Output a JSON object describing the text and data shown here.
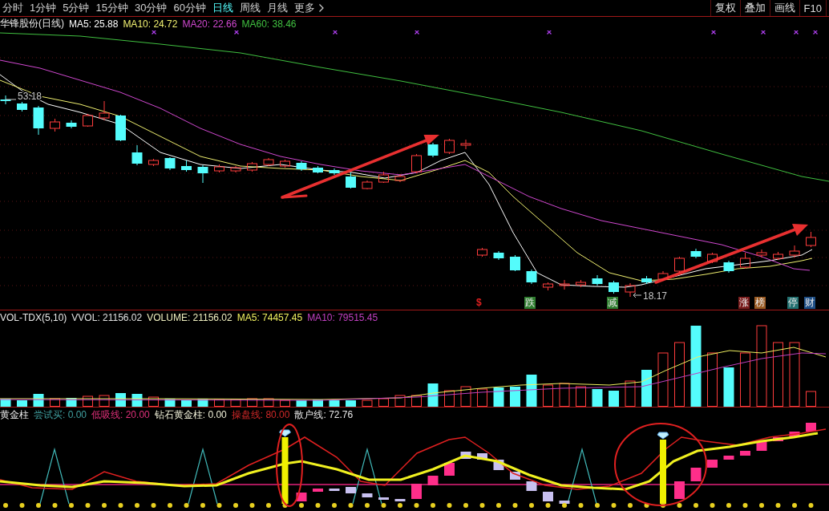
{
  "toolbar": {
    "tabs": [
      {
        "label": "分时",
        "selected": false,
        "kind": "period"
      },
      {
        "label": "1分钟",
        "selected": false,
        "kind": "period"
      },
      {
        "label": "5分钟",
        "selected": false,
        "kind": "period"
      },
      {
        "label": "15分钟",
        "selected": false,
        "kind": "period"
      },
      {
        "label": "30分钟",
        "selected": false,
        "kind": "period"
      },
      {
        "label": "60分钟",
        "selected": false,
        "kind": "period"
      },
      {
        "label": "日线",
        "selected": true,
        "kind": "period"
      },
      {
        "label": "周线",
        "selected": false,
        "kind": "period"
      },
      {
        "label": "月线",
        "selected": false,
        "kind": "period"
      },
      {
        "label": "更多",
        "selected": false,
        "kind": "menu"
      }
    ],
    "buttons": [
      "复权",
      "叠加",
      "画线",
      "F10"
    ]
  },
  "main_chart": {
    "title": "华锋股份(日线)",
    "indicators": [
      {
        "label": "MA5: 25.88",
        "color": "#ffffff"
      },
      {
        "label": "MA10: 24.72",
        "color": "#f0f070"
      },
      {
        "label": "MA20: 22.66",
        "color": "#d048d0"
      },
      {
        "label": "MA60: 38.46",
        "color": "#40c040"
      }
    ],
    "high_label": "53.18",
    "low_label": "18.17",
    "events": [
      {
        "label": "$",
        "kind": "text",
        "color": "#e02020"
      },
      {
        "label": "跌",
        "kind": "badge",
        "color": "#2f7d2f"
      },
      {
        "label": "减",
        "kind": "badge",
        "color": "#2f7d2f"
      },
      {
        "label": "涨",
        "kind": "badge",
        "color": "#7a1c1c"
      },
      {
        "label": "榜",
        "kind": "badge",
        "color": "#9a5a22"
      },
      {
        "label": "停",
        "kind": "badge",
        "color": "#227070"
      },
      {
        "label": "财",
        "kind": "badge",
        "color": "#1f4f86"
      }
    ]
  },
  "volume_chart": {
    "title": "VOL-TDX(5,10)",
    "indicators": [
      {
        "label": "VVOL: 21156.02",
        "color": "#e0e0e0"
      },
      {
        "label": "VOLUME: 21156.02",
        "color": "#f0f0c0"
      },
      {
        "label": "MA5: 74457.45",
        "color": "#f0f060"
      },
      {
        "label": "MA10: 79515.45",
        "color": "#c040c0"
      }
    ]
  },
  "indicator_chart": {
    "title": "黄金柱",
    "indicators": [
      {
        "label": "尝试买: 0.00",
        "color": "#40a0a0"
      },
      {
        "label": "低吸线: 20.00",
        "color": "#e0307a"
      },
      {
        "label": "钻石黄金柱: 0.00",
        "color": "#f0f0d8"
      },
      {
        "label": "操盘线: 80.00",
        "color": "#d02828"
      },
      {
        "label": "散户线: 72.76",
        "color": "#e8e8e8"
      }
    ]
  }
}
